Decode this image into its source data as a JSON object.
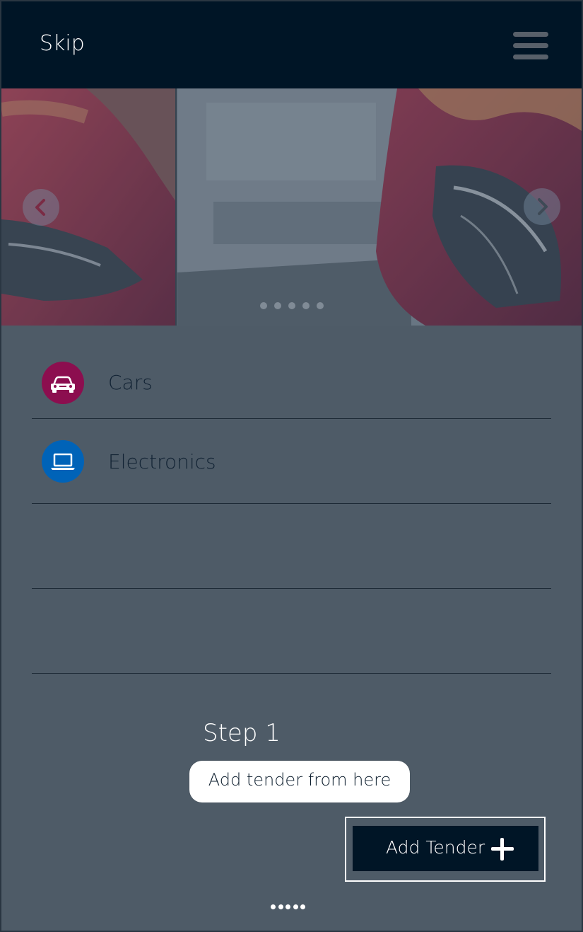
{
  "header": {
    "skip_label": "Skip",
    "menu_icon": "hamburger-menu-icon"
  },
  "carousel": {
    "prev_icon": "chevron-left-icon",
    "next_icon": "chevron-right-icon",
    "slide_count": 5
  },
  "categories": [
    {
      "label": "Cars",
      "icon": "car-icon",
      "color": "#8c0e4f"
    },
    {
      "label": "Electronics",
      "icon": "laptop-icon",
      "color": "#0063b8"
    }
  ],
  "tutorial": {
    "step_title": "Step 1",
    "hint_text": "Add tender from here"
  },
  "add_tender": {
    "label": "Add Tender",
    "icon": "plus-icon"
  },
  "colors": {
    "header_bg": "#001526",
    "overlay_bg": "#4e5b67"
  }
}
